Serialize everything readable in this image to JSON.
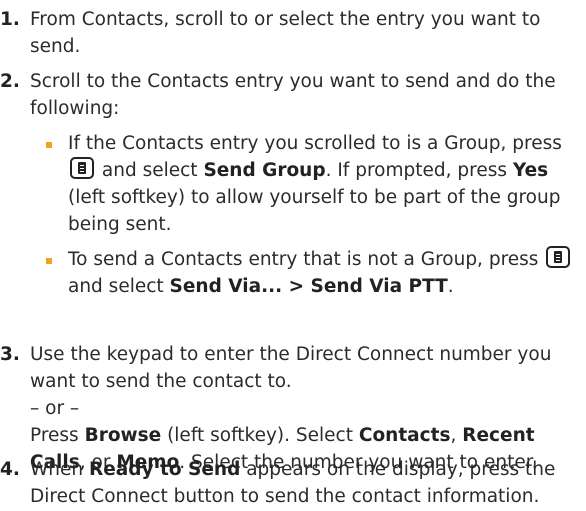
{
  "steps": [
    {
      "number": "1.",
      "text": "From Contacts, scroll to or select the entry you want to send."
    },
    {
      "number": "2.",
      "text": "Scroll to the Contacts entry you want to send and do the following:",
      "bullets": [
        {
          "t1": "If the Contacts entry you scrolled to is a Group, press",
          "t2": "and select",
          "b1": "Send Group",
          "t3": ". If prompted, press",
          "b2": "Yes",
          "t4": "(left softkey) to allow yourself to be part of the group being sent."
        },
        {
          "t1": "To send a Contacts entry that is not a Group, press",
          "t2": "and select",
          "b1": "Send Via... > Send Via PTT",
          "t3": "."
        }
      ]
    },
    {
      "number": "3.",
      "text": "Use the keypad to enter the Direct Connect number you want to send the contact to.",
      "or": "– or –",
      "p1": "Press",
      "b1": "Browse",
      "p2": "(left softkey). Select",
      "b2": "Contacts",
      "p3": ",",
      "b3": "Recent Calls",
      "p4": ", or",
      "b4": "Memo",
      "p5": ". Select the number you want to enter."
    },
    {
      "number": "4.",
      "p1": "When",
      "b1": "Ready to Send",
      "p2": "appears on the display, press the Direct Connect button to send the contact information."
    }
  ],
  "icons": {
    "menu_key": "menu-key-icon",
    "bullet_color": "#f5a11c"
  }
}
